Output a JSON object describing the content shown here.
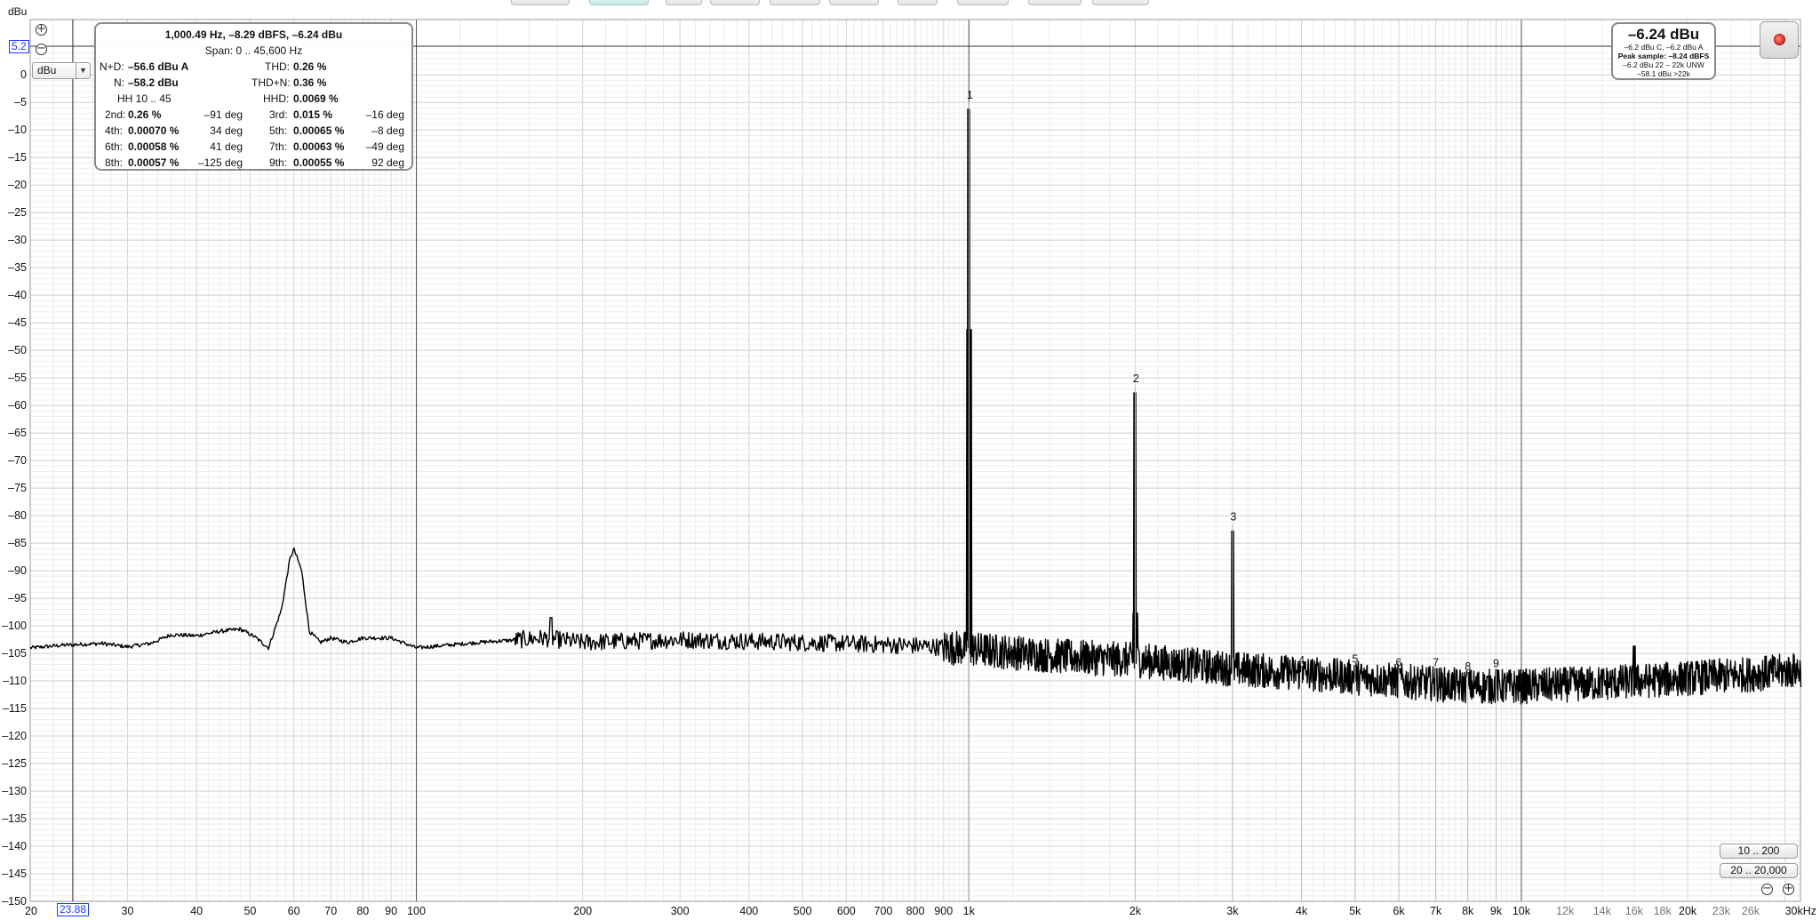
{
  "toolbar": {
    "button_count": 10,
    "active_index": 1
  },
  "unit_title": "dBu",
  "level_cursor_value": "5.2",
  "freq_cursor_value": "23.88",
  "unit_select": {
    "value": "dBu"
  },
  "icons": {
    "zoom_in": "zoom-in-icon",
    "zoom_out": "zoom-out-icon",
    "record": "record-icon",
    "dropdown": "chevron-down-icon"
  },
  "stats": {
    "header": "1,000.49 Hz, –8.29 dBFS, –6.24 dBu",
    "span": "Span: 0 .. 45,600 Hz",
    "nd_label": "N+D:",
    "nd_value": "–56.6 dBu A",
    "thd_label": "THD:",
    "thd_value": "0.26 %",
    "n_label": "N:",
    "n_value": "–58.2 dBu",
    "thdn_label": "THD+N:",
    "thdn_value": "0.36 %",
    "hh_label": "HH 10 .. 45",
    "hhd_label": "HHD:",
    "hhd_value": "0.0069 %",
    "harmonics": [
      {
        "label": "2nd:",
        "value": "0.26 %",
        "phase": "–91 deg"
      },
      {
        "label": "3rd:",
        "value": "0.015 %",
        "phase": "–16 deg"
      },
      {
        "label": "4th:",
        "value": "0.00070 %",
        "phase": "34 deg"
      },
      {
        "label": "5th:",
        "value": "0.00065 %",
        "phase": "–8 deg"
      },
      {
        "label": "6th:",
        "value": "0.00058 %",
        "phase": "41 deg"
      },
      {
        "label": "7th:",
        "value": "0.00063 %",
        "phase": "–49 deg"
      },
      {
        "label": "8th:",
        "value": "0.00057 %",
        "phase": "–125 deg"
      },
      {
        "label": "9th:",
        "value": "0.00055 %",
        "phase": "92 deg"
      }
    ]
  },
  "level_meter": {
    "big": "–6.24 dBu",
    "line1": "–6.2 dBu C, –6.2 dBu A",
    "line2": "Peak sample: –8.24 dBFS",
    "line3": "–6.2 dBu 22 – 22k UNW",
    "line4": "–58.1 dBu >22k"
  },
  "range_buttons": [
    "10 .. 200",
    "20 .. 20,000"
  ],
  "colors": {
    "trace": "#000000",
    "grid": "#d9d9d9",
    "cursor": "#1a3cff",
    "axis_dark": "#555555"
  },
  "chart_data": {
    "type": "line",
    "title": "1,000.49 Hz, –8.29 dBFS, –6.24 dBu",
    "xlabel": "",
    "ylabel": "dBu",
    "x_scale": "log",
    "xlim": [
      20,
      32000
    ],
    "ylim": [
      -150,
      5.2
    ],
    "grid": true,
    "x_ticks": [
      {
        "v": 20,
        "t": "20"
      },
      {
        "v": 30,
        "t": "30"
      },
      {
        "v": 40,
        "t": "40"
      },
      {
        "v": 50,
        "t": "50"
      },
      {
        "v": 60,
        "t": "60"
      },
      {
        "v": 70,
        "t": "70"
      },
      {
        "v": 80,
        "t": "80"
      },
      {
        "v": 90,
        "t": "90"
      },
      {
        "v": 100,
        "t": "100"
      },
      {
        "v": 200,
        "t": "200"
      },
      {
        "v": 300,
        "t": "300"
      },
      {
        "v": 400,
        "t": "400"
      },
      {
        "v": 500,
        "t": "500"
      },
      {
        "v": 600,
        "t": "600"
      },
      {
        "v": 700,
        "t": "700"
      },
      {
        "v": 800,
        "t": "800"
      },
      {
        "v": 900,
        "t": "900"
      },
      {
        "v": 1000,
        "t": "1k"
      },
      {
        "v": 2000,
        "t": "2k"
      },
      {
        "v": 3000,
        "t": "3k"
      },
      {
        "v": 4000,
        "t": "4k"
      },
      {
        "v": 5000,
        "t": "5k"
      },
      {
        "v": 6000,
        "t": "6k"
      },
      {
        "v": 7000,
        "t": "7k"
      },
      {
        "v": 8000,
        "t": "8k"
      },
      {
        "v": 9000,
        "t": "9k"
      },
      {
        "v": 10000,
        "t": "10k"
      },
      {
        "v": 12000,
        "t": "12k",
        "minor": true
      },
      {
        "v": 14000,
        "t": "14k",
        "minor": true
      },
      {
        "v": 16000,
        "t": "16k",
        "minor": true
      },
      {
        "v": 18000,
        "t": "18k",
        "minor": true
      },
      {
        "v": 20000,
        "t": "20k"
      },
      {
        "v": 23000,
        "t": "23k",
        "minor": true
      },
      {
        "v": 26000,
        "t": "26k",
        "minor": true
      },
      {
        "v": 30000,
        "t": "30kHz"
      }
    ],
    "y_ticks": [
      0,
      -5,
      -10,
      -15,
      -20,
      -25,
      -30,
      -35,
      -40,
      -45,
      -50,
      -55,
      -60,
      -65,
      -70,
      -75,
      -80,
      -85,
      -90,
      -95,
      -100,
      -105,
      -110,
      -115,
      -120,
      -125,
      -130,
      -135,
      -140,
      -145,
      -150
    ],
    "noise_floor": [
      [
        20,
        -104.0
      ],
      [
        23,
        -103.5
      ],
      [
        27,
        -103.2
      ],
      [
        30,
        -103.8
      ],
      [
        33,
        -103.2
      ],
      [
        36,
        -101.6
      ],
      [
        40,
        -101.8
      ],
      [
        44,
        -101.0
      ],
      [
        48,
        -100.6
      ],
      [
        51,
        -102.0
      ],
      [
        54,
        -104.0
      ],
      [
        57,
        -97.0
      ],
      [
        59,
        -88.0
      ],
      [
        60,
        -86.0
      ],
      [
        62,
        -90.0
      ],
      [
        64,
        -101.0
      ],
      [
        67,
        -103.0
      ],
      [
        70,
        -102.2
      ],
      [
        75,
        -103.0
      ],
      [
        80,
        -102.2
      ],
      [
        90,
        -102.2
      ],
      [
        100,
        -104.0
      ],
      [
        130,
        -103.0
      ],
      [
        170,
        -102.2
      ],
      [
        200,
        -103.0
      ],
      [
        300,
        -102.5
      ],
      [
        400,
        -102.8
      ],
      [
        600,
        -103.2
      ],
      [
        800,
        -103.6
      ],
      [
        950,
        -104.0
      ],
      [
        1500,
        -105.6
      ],
      [
        2000,
        -106.2
      ],
      [
        3000,
        -107.8
      ],
      [
        4000,
        -108.6
      ],
      [
        6000,
        -110.0
      ],
      [
        8000,
        -111.0
      ],
      [
        10000,
        -111.0
      ],
      [
        14000,
        -110.4
      ],
      [
        20000,
        -109.5
      ],
      [
        26000,
        -108.8
      ],
      [
        32000,
        -108.0
      ]
    ],
    "noise_ripple_db": 3.2,
    "peaks": [
      {
        "label": "1",
        "f": 1000.49,
        "level": -6.24
      },
      {
        "label": "2",
        "f": 2000,
        "level": -57.7
      },
      {
        "label": "3",
        "f": 3000,
        "level": -82.8
      },
      {
        "label": "4",
        "f": 4000,
        "level": -107.4
      },
      {
        "label": "5",
        "f": 5000,
        "level": -107.2
      },
      {
        "label": "6",
        "f": 6000,
        "level": -107.8
      },
      {
        "label": "7",
        "f": 7000,
        "level": -107.8
      },
      {
        "label": "8",
        "f": 8000,
        "level": -108.5
      },
      {
        "label": "9",
        "f": 9000,
        "level": -108.0
      }
    ],
    "spurs": [
      {
        "f": 175,
        "level": -98.5
      },
      {
        "f": 16000,
        "level": -103.7
      }
    ],
    "cursors": {
      "level": 5.2,
      "freq": 23.88
    }
  }
}
